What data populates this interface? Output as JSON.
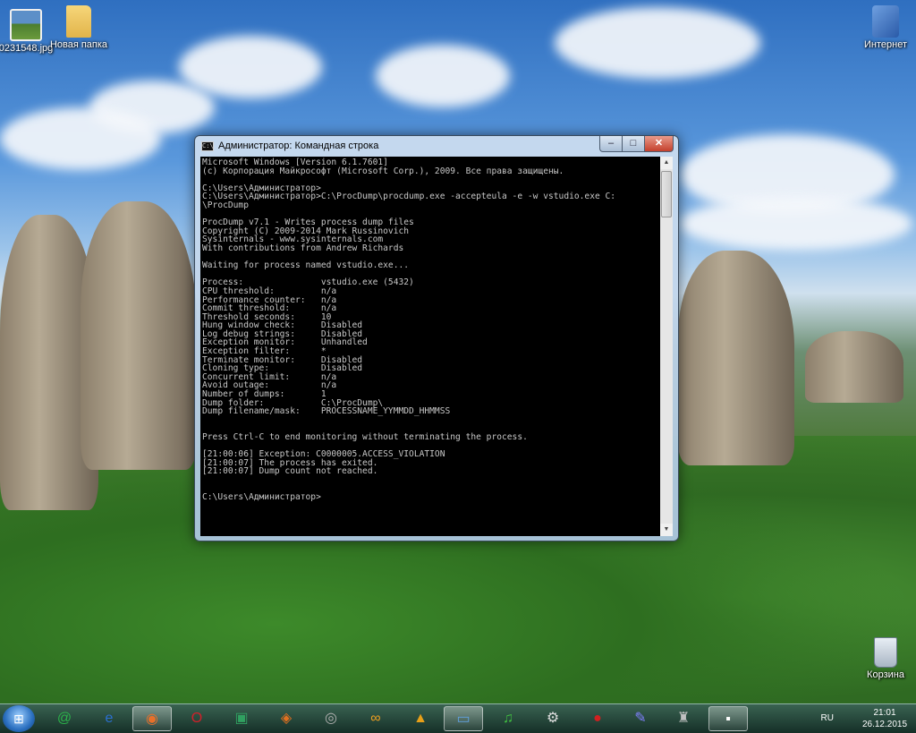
{
  "desktop": {
    "icons": [
      {
        "label": "0231548.jpg",
        "icon": "image-file-icon"
      },
      {
        "label": "Новая папка",
        "icon": "folder-icon"
      },
      {
        "label": "Интернет",
        "icon": "network-icon"
      },
      {
        "label": "Корзина",
        "icon": "recycle-bin-icon"
      }
    ]
  },
  "window": {
    "title": "Администратор: Командная строка",
    "title_icon_text": "C:\\",
    "controls": {
      "minimize": "–",
      "maximize": "□",
      "close": "✕"
    },
    "console_lines": [
      "Microsoft Windows [Version 6.1.7601]",
      "(c) Корпорация Майкрософт (Microsoft Corp.), 2009. Все права защищены.",
      "",
      "C:\\Users\\Администратор>",
      "C:\\Users\\Администратор>C:\\ProcDump\\procdump.exe -accepteula -e -w vstudio.exe C:",
      "\\ProcDump",
      "",
      "ProcDump v7.1 - Writes process dump files",
      "Copyright (C) 2009-2014 Mark Russinovich",
      "Sysinternals - www.sysinternals.com",
      "With contributions from Andrew Richards",
      "",
      "Waiting for process named vstudio.exe...",
      "",
      "Process:               vstudio.exe (5432)",
      "CPU threshold:         n/a",
      "Performance counter:   n/a",
      "Commit threshold:      n/a",
      "Threshold seconds:     10",
      "Hung window check:     Disabled",
      "Log debug strings:     Disabled",
      "Exception monitor:     Unhandled",
      "Exception filter:      *",
      "Terminate monitor:     Disabled",
      "Cloning type:          Disabled",
      "Concurrent limit:      n/a",
      "Avoid outage:          n/a",
      "Number of dumps:       1",
      "Dump folder:           C:\\ProcDump\\",
      "Dump filename/mask:    PROCESSNAME_YYMMDD_HHMMSS",
      "",
      "",
      "Press Ctrl-C to end monitoring without terminating the process.",
      "",
      "[21:00:06] Exception: C0000005.ACCESS_VIOLATION",
      "[21:00:07] The process has exited.",
      "[21:00:07] Dump count not reached.",
      "",
      "",
      "C:\\Users\\Администратор>"
    ],
    "scrollbar": {
      "up": "▲",
      "down": "▼"
    }
  },
  "taskbar": {
    "start_symbol": "⊞",
    "buttons": [
      {
        "name": "mail-agent-icon",
        "glyph": "@",
        "color": "#2bb34a"
      },
      {
        "name": "ie-app-icon",
        "glyph": "e",
        "color": "#2a6fd0"
      },
      {
        "name": "firefox-icon",
        "glyph": "◉",
        "color": "#e8702a",
        "active": true
      },
      {
        "name": "opera-icon",
        "glyph": "O",
        "color": "#d0202a"
      },
      {
        "name": "display-app-icon",
        "glyph": "▣",
        "color": "#30a060"
      },
      {
        "name": "eye-app-icon",
        "glyph": "◈",
        "color": "#e07020"
      },
      {
        "name": "player-app-icon",
        "glyph": "◎",
        "color": "#b0b0b0"
      },
      {
        "name": "swirl-app-icon",
        "glyph": "∞",
        "color": "#f0a020"
      },
      {
        "name": "warning-app-icon",
        "glyph": "▲",
        "color": "#e8a018"
      },
      {
        "name": "monitor-app-icon",
        "glyph": "▭",
        "color": "#60a0e0",
        "active": true
      },
      {
        "name": "mp3-app-icon",
        "glyph": "♫",
        "color": "#40c040"
      },
      {
        "name": "steam-icon",
        "glyph": "⚙",
        "color": "#dddddd"
      },
      {
        "name": "apple-app-icon",
        "glyph": "●",
        "color": "#d02020"
      },
      {
        "name": "pen-app-icon",
        "glyph": "✎",
        "color": "#8080ff"
      },
      {
        "name": "bottle-app-icon",
        "glyph": "♜",
        "color": "#c0c0c0"
      },
      {
        "name": "cmd-taskbar-icon",
        "glyph": "▪",
        "color": "#ffffff",
        "active": true
      }
    ],
    "language": "RU",
    "time": "21:01",
    "date": "26.12.2015"
  }
}
